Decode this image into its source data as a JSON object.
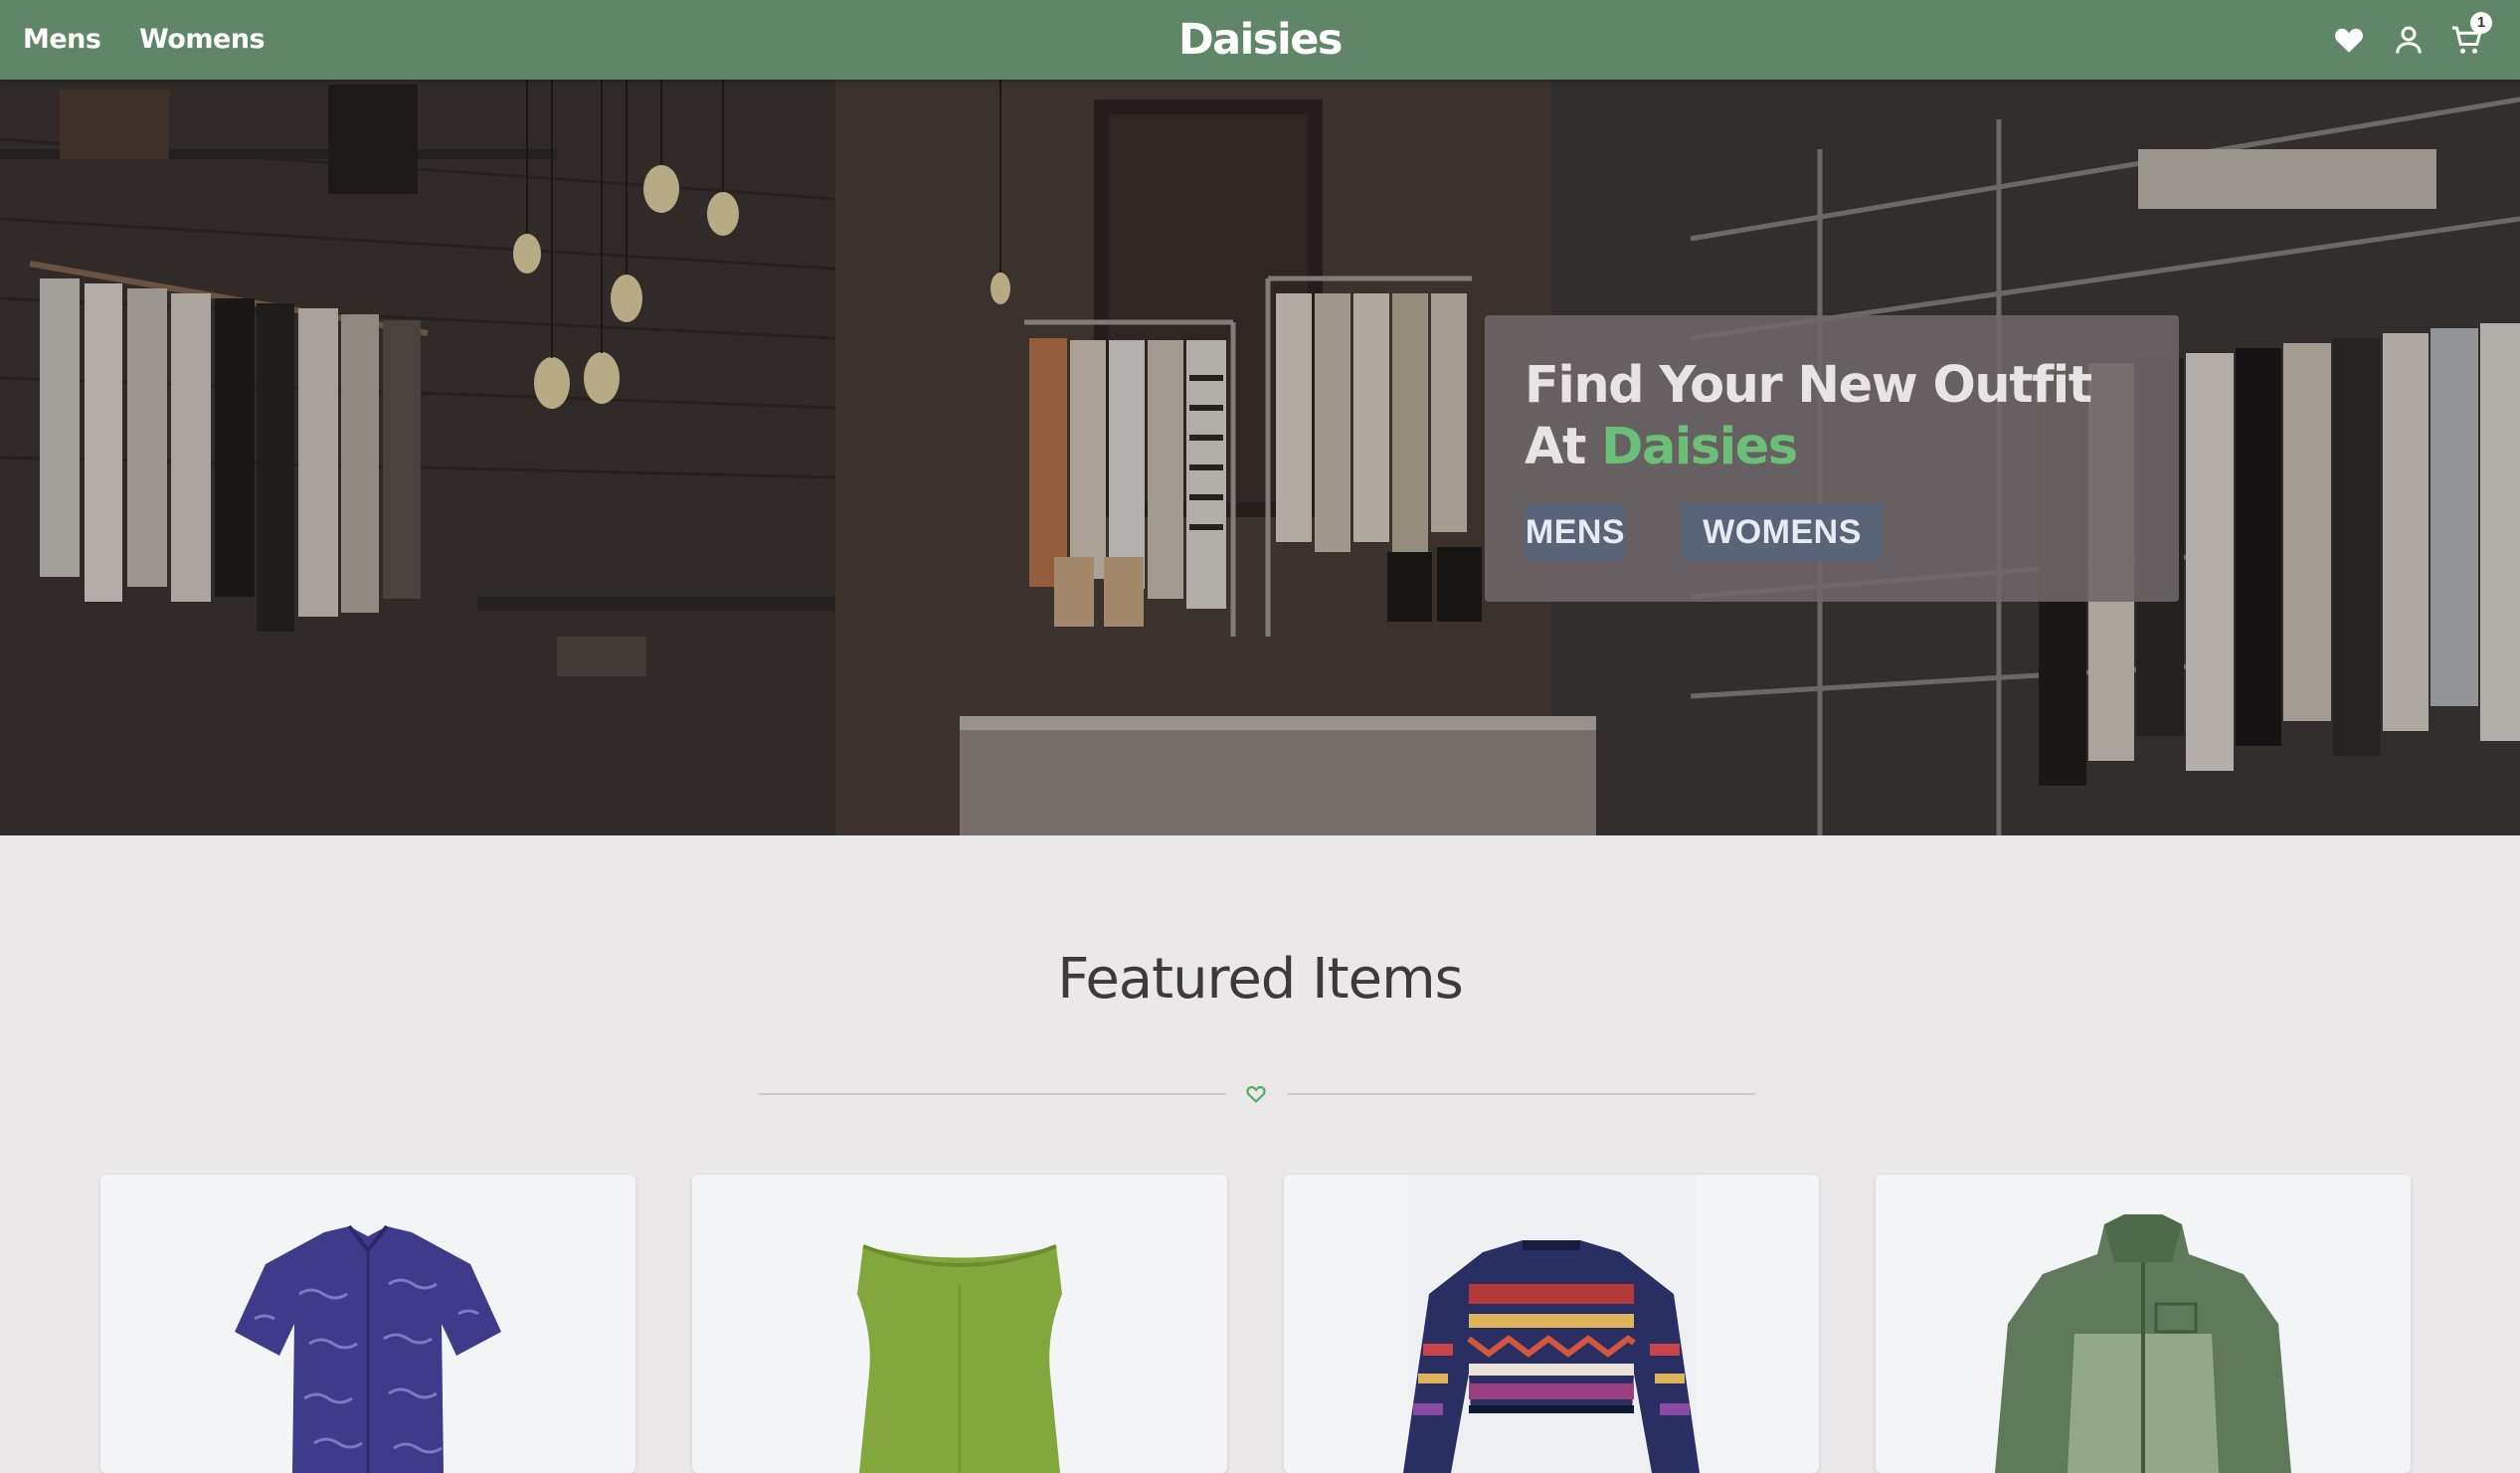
{
  "nav": {
    "links": [
      {
        "label": "Mens"
      },
      {
        "label": "Womens"
      }
    ],
    "brand": "Daisies",
    "icons": [
      "heart-icon",
      "user-icon",
      "cart-icon"
    ],
    "cart_count": "1"
  },
  "hero": {
    "title_line1": "Find Your New Outfit",
    "title_at": "At ",
    "title_brand": "Daisies",
    "buttons": [
      {
        "label": "MENS"
      },
      {
        "label": "WOMENS"
      }
    ]
  },
  "featured": {
    "title": "Featured Items",
    "divider_icon": "heart-outline-icon",
    "products": [
      {
        "name": "patterned-shirt"
      },
      {
        "name": "green-sleeveless-top"
      },
      {
        "name": "patterned-sweater"
      },
      {
        "name": "green-jacket"
      }
    ]
  },
  "colors": {
    "nav_bg": "#5f8767",
    "accent_green": "#6bbf77",
    "button_bg": "#5a6478",
    "page_bg": "#eae8e9"
  }
}
